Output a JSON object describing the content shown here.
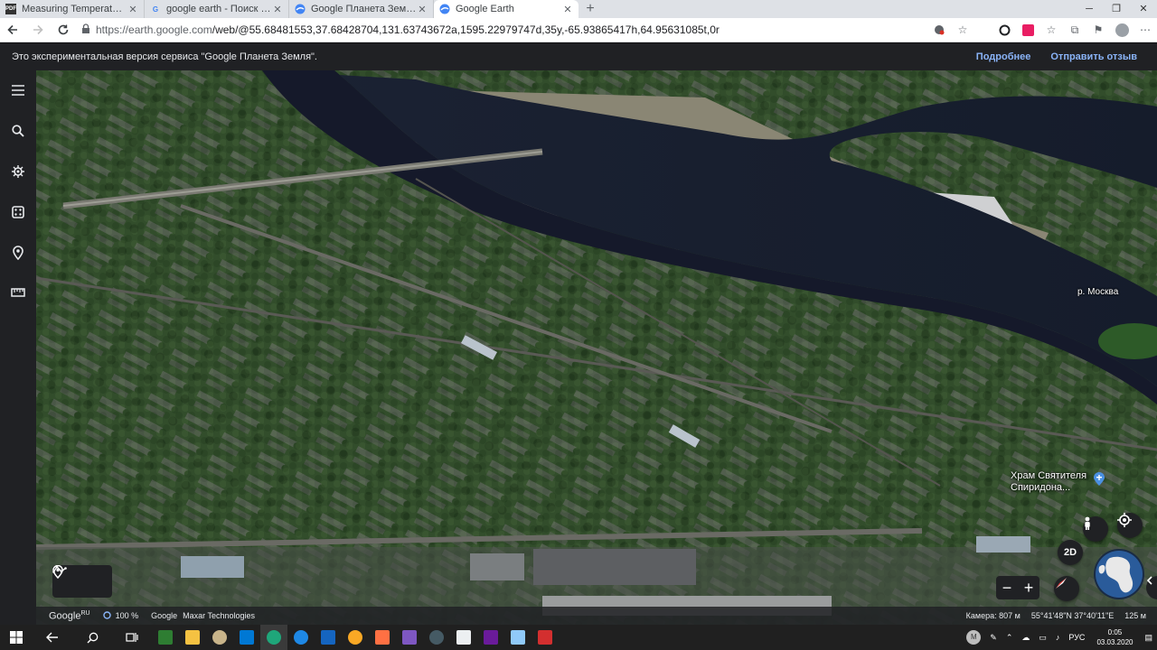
{
  "tabs": [
    {
      "title": "Measuring Temperature using P",
      "favicon": "pdf-doc-icon",
      "active": false
    },
    {
      "title": "google earth - Поиск в Google",
      "favicon": "google-g-icon",
      "active": false
    },
    {
      "title": "Google Планета Земля",
      "favicon": "earth-icon",
      "active": false
    },
    {
      "title": "Google Earth",
      "favicon": "earth-icon",
      "active": true
    }
  ],
  "address": {
    "host": "https://earth.google.com",
    "path": "/web/@55.68481553,37.68428704,131.63743672a,1595.22979747d,35y,-65.93865417h,64.95631085t,0r"
  },
  "banner": {
    "message": "Это экспериментальная версия сервиса \"Google Планета Земля\".",
    "learn_more": "Подробнее",
    "feedback": "Отправить отзыв"
  },
  "map": {
    "river_label": "р. Москва",
    "place_label_line1": "Храм Святителя",
    "place_label_line2": "Спиридона...",
    "view_mode": "2D"
  },
  "footer": {
    "logo": "Google",
    "logo_sup": "RU",
    "loaded": "100 %",
    "credit1": "Google",
    "credit2": "Maxar Technologies",
    "camera": "Камера: 807 м",
    "coords": "55°41'48\"N 37°40'11\"E",
    "scale": "125 м"
  },
  "taskbar": {
    "lang": "РУС",
    "time": "0:05",
    "date": "03.03.2020"
  },
  "colors": {
    "sidebar": "#202124",
    "banner_link": "#8ab4f8",
    "river": "#1a1f2e"
  }
}
